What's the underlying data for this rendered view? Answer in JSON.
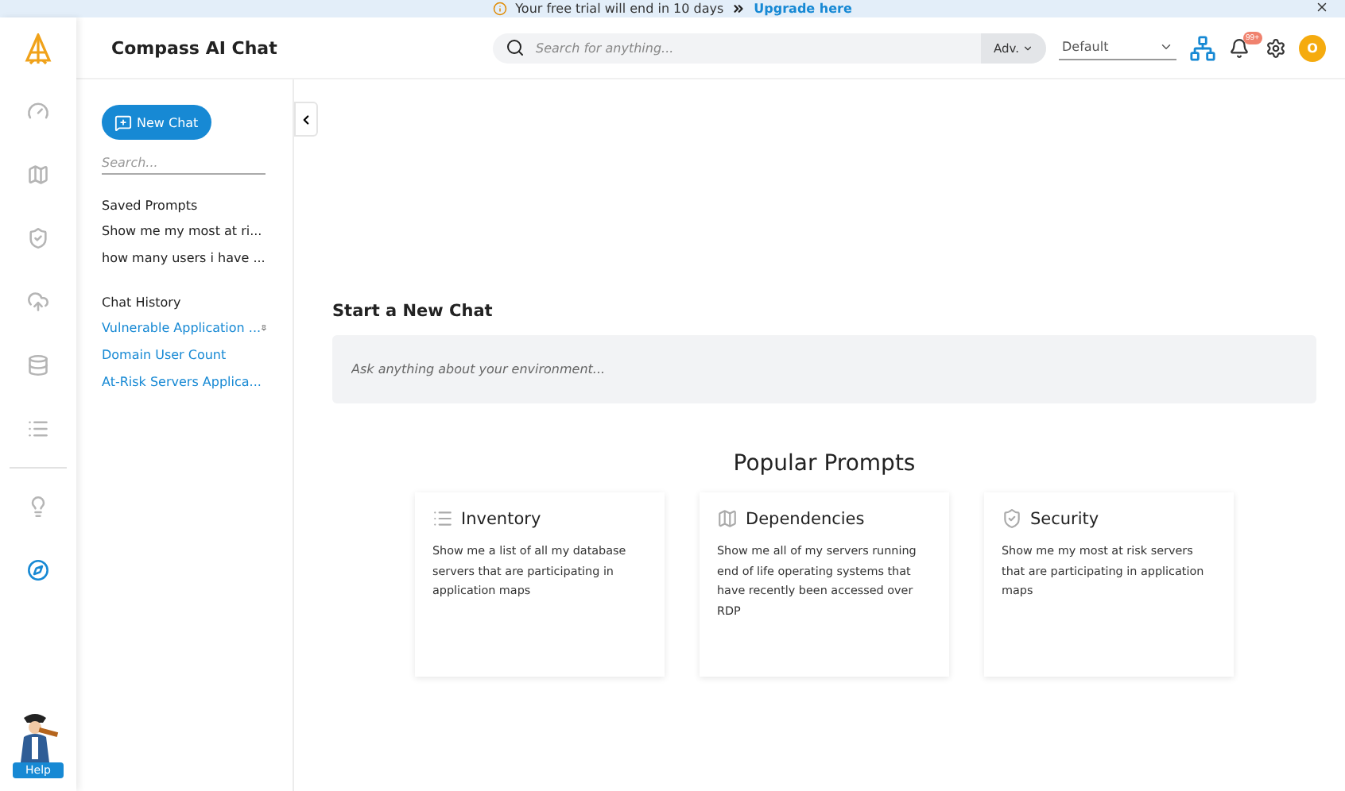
{
  "banner": {
    "message": "Your free trial will end in 10 days",
    "link": "Upgrade here"
  },
  "header": {
    "title": "Compass AI Chat",
    "search": {
      "placeholder": "Search for anything..."
    },
    "advanced": "Adv.",
    "view_select": "Default",
    "notification_count": "99+",
    "avatar": "O"
  },
  "rail": [
    {
      "kind": "gauge",
      "selected": false
    },
    {
      "kind": "map",
      "selected": false
    },
    {
      "kind": "shield",
      "selected": false
    },
    {
      "kind": "cloud",
      "selected": false
    },
    {
      "kind": "database",
      "selected": false
    },
    {
      "kind": "list",
      "selected": false
    },
    {
      "kind": "divider"
    },
    {
      "kind": "bulb",
      "selected": false
    },
    {
      "kind": "compass",
      "selected": true
    }
  ],
  "help": "Help",
  "sidebar": {
    "new_chat": "New Chat",
    "search": {
      "placeholder": "Search..."
    },
    "saved_title": "Saved Prompts",
    "saved": [
      "Show me my most at ri...",
      "how many users i have ..."
    ],
    "history_title": "Chat History",
    "history": [
      {
        "label": "Vulnerable Application ...",
        "pinned": true
      },
      {
        "label": "Domain User Count",
        "pinned": false
      },
      {
        "label": "At-Risk Servers Applica...",
        "pinned": false
      }
    ]
  },
  "main": {
    "heading": "Start a New Chat",
    "prompt": {
      "placeholder": "Ask anything about your environment..."
    },
    "popular_title": "Popular Prompts",
    "cards": [
      {
        "kind": "list",
        "title": "Inventory",
        "text": "Show me a list of all my database servers that are participating in application maps"
      },
      {
        "kind": "map",
        "title": "Dependencies",
        "text": "Show me all of my servers running end of life operating systems that have recently been accessed over RDP"
      },
      {
        "kind": "shield",
        "title": "Security",
        "text": "Show me my most at risk servers that are participating in application maps"
      }
    ]
  }
}
